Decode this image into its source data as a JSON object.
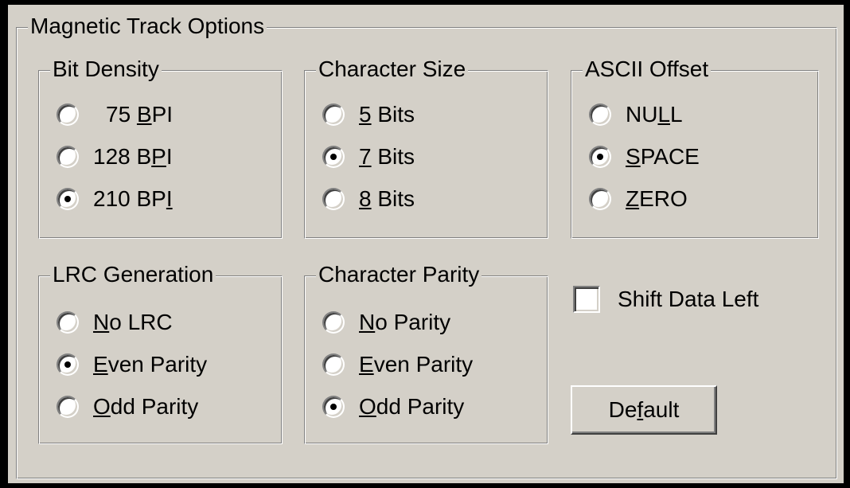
{
  "title": "Magnetic Track Options",
  "groups": {
    "bit_density": {
      "label": "Bit Density",
      "options": [
        {
          "pre": "75 ",
          "u": "B",
          "post": "PI",
          "checked": false
        },
        {
          "pre": "128 B",
          "u": "P",
          "post": "I",
          "checked": false
        },
        {
          "pre": "210 BP",
          "u": "I",
          "post": "",
          "checked": true
        }
      ]
    },
    "char_size": {
      "label": "Character Size",
      "options": [
        {
          "pre": "",
          "u": "5",
          "post": " Bits",
          "checked": false
        },
        {
          "pre": "",
          "u": "7",
          "post": " Bits",
          "checked": true
        },
        {
          "pre": "",
          "u": "8",
          "post": " Bits",
          "checked": false
        }
      ]
    },
    "ascii_offset": {
      "label": "ASCII Offset",
      "options": [
        {
          "pre": "NU",
          "u": "L",
          "post": "L",
          "checked": false
        },
        {
          "pre": "",
          "u": "S",
          "post": "PACE",
          "checked": true
        },
        {
          "pre": "",
          "u": "Z",
          "post": "ERO",
          "checked": false
        }
      ]
    },
    "lrc": {
      "label": "LRC Generation",
      "options": [
        {
          "pre": "",
          "u": "N",
          "post": "o LRC",
          "checked": false
        },
        {
          "pre": "",
          "u": "E",
          "post": "ven Parity",
          "checked": true
        },
        {
          "pre": "",
          "u": "O",
          "post": "dd Parity",
          "checked": false
        }
      ]
    },
    "char_parity": {
      "label": "Character Parity",
      "options": [
        {
          "pre": "",
          "u": "N",
          "post": "o Parity",
          "checked": false
        },
        {
          "pre": "",
          "u": "E",
          "post": "ven Parity",
          "checked": false
        },
        {
          "pre": "",
          "u": "O",
          "post": "dd Parity",
          "checked": true
        }
      ]
    }
  },
  "shift": {
    "label": "Shift Data Left",
    "checked": false
  },
  "default_button": {
    "pre": "De",
    "u": "f",
    "post": "ault"
  }
}
